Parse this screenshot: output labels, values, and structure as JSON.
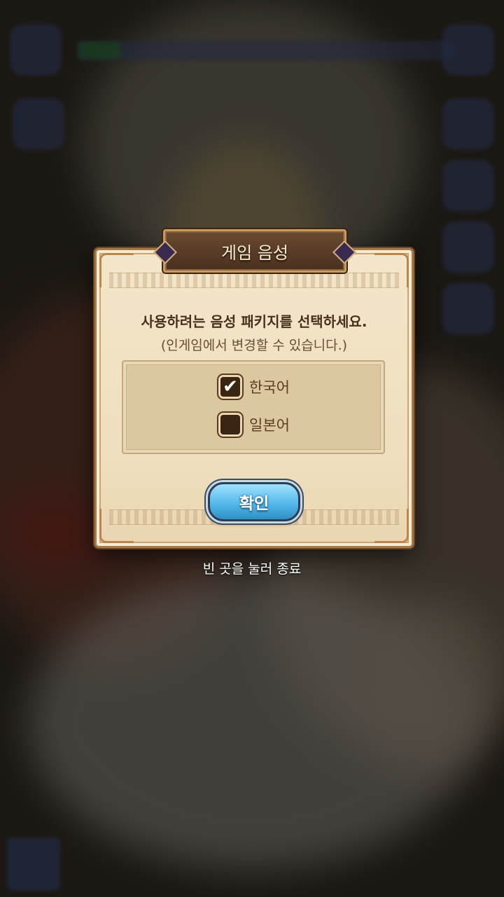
{
  "dialog": {
    "title": "게임 음성",
    "message": "사용하려는 음성 패키지를 선택하세요.",
    "sub_message": "(인게임에서 변경할 수 있습니다.)",
    "options": [
      {
        "label": "한국어",
        "checked": true,
        "check_glyph": "✔"
      },
      {
        "label": "일본어",
        "checked": false,
        "check_glyph": ""
      }
    ],
    "confirm_label": "확인"
  },
  "close_hint": "빈 곳을 눌러 종료",
  "colors": {
    "dialog_background": "#f3e6c9",
    "title_banner": "#5a3c26",
    "confirm_button": "#56b9ea",
    "checkbox_fill": "#3a2412"
  },
  "icons": {
    "checked": "check-icon"
  }
}
